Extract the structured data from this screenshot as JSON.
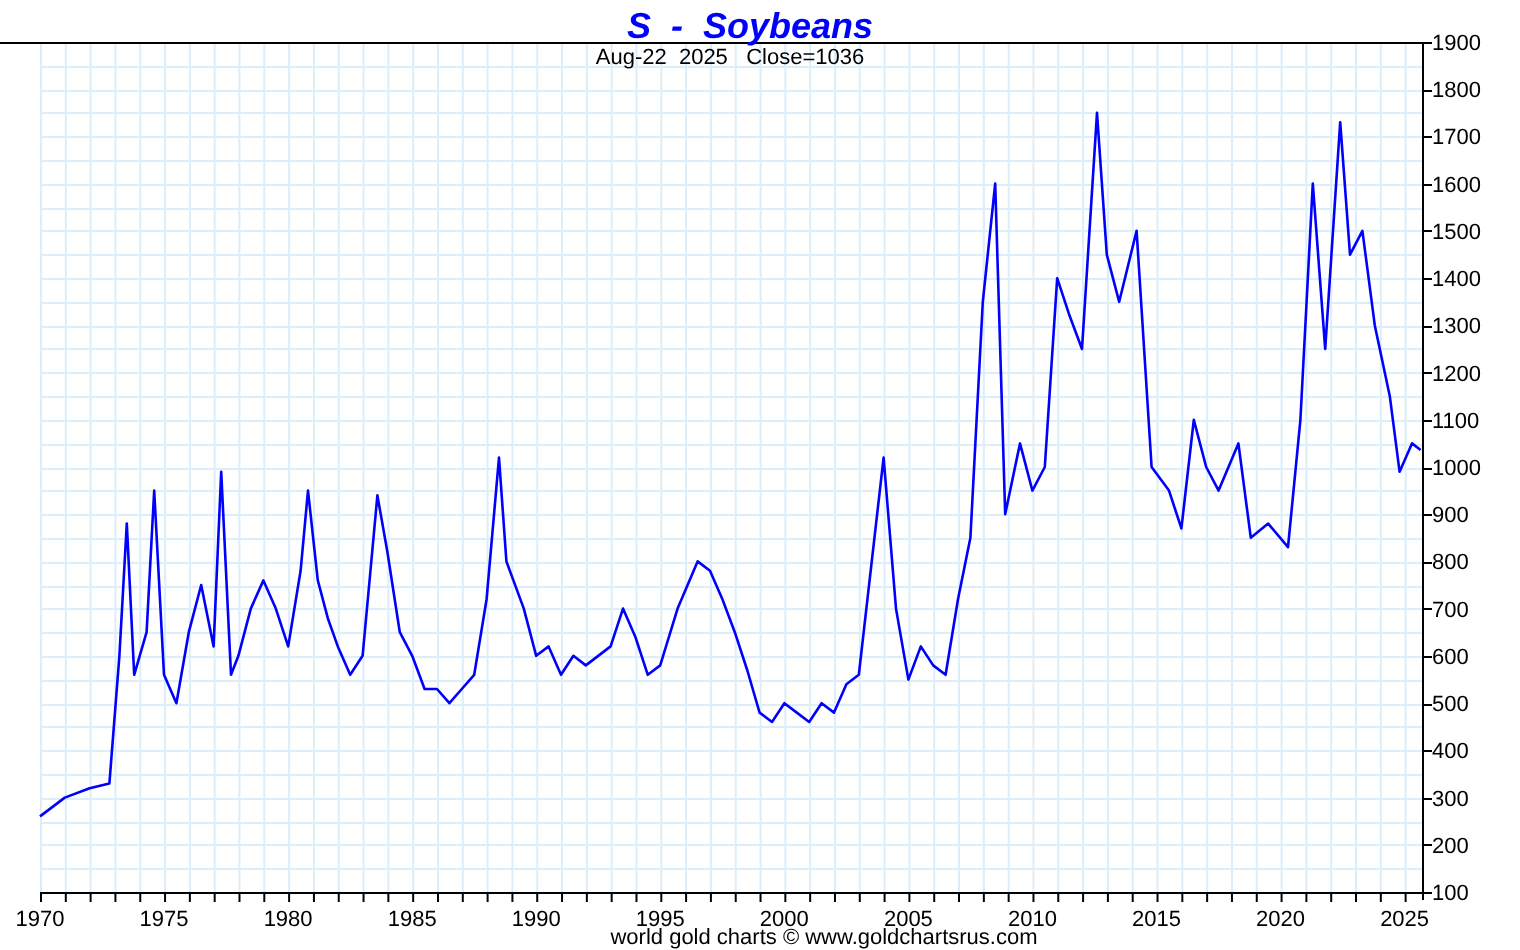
{
  "chart": {
    "title": "S  -  Soybeans",
    "subtitle": "Aug-22  2025   Close=1036",
    "chart_data": {
      "type": "line",
      "x": [
        1970,
        1971,
        1972,
        1972.8,
        1973.2,
        1973.5,
        1973.8,
        1974.3,
        1974.6,
        1975,
        1975.5,
        1976,
        1976.5,
        1977,
        1977.3,
        1977.7,
        1978,
        1978.5,
        1979,
        1979.5,
        1980,
        1980.5,
        1980.8,
        1981.2,
        1981.6,
        1982,
        1982.5,
        1983,
        1983.6,
        1984,
        1984.5,
        1985,
        1985.5,
        1986,
        1986.5,
        1987,
        1987.5,
        1988,
        1988.5,
        1988.8,
        1989.5,
        1990,
        1990.5,
        1991,
        1991.5,
        1992,
        1993,
        1993.5,
        1994,
        1994.5,
        1995,
        1995.7,
        1996.5,
        1997,
        1997.5,
        1998,
        1998.5,
        1999,
        1999.5,
        2000,
        2000.5,
        2001,
        2001.5,
        2002,
        2002.5,
        2003,
        2004,
        2004.5,
        2005,
        2005.5,
        2006,
        2006.5,
        2007,
        2007.5,
        2008,
        2008.5,
        2008.9,
        2009.5,
        2010,
        2010.5,
        2011,
        2011.5,
        2012,
        2012.6,
        2013,
        2013.5,
        2014.2,
        2014.8,
        2015.5,
        2016,
        2016.5,
        2017,
        2017.5,
        2018.3,
        2018.8,
        2019.5,
        2020.3,
        2020.8,
        2021.3,
        2021.8,
        2022.4,
        2022.8,
        2023.3,
        2023.8,
        2024.4,
        2024.8,
        2025.3,
        2025.64
      ],
      "series": [
        {
          "color": "#0000ff",
          "values": [
            260,
            300,
            320,
            330,
            600,
            880,
            560,
            650,
            950,
            560,
            500,
            650,
            750,
            620,
            990,
            560,
            600,
            700,
            760,
            700,
            620,
            780,
            950,
            760,
            680,
            620,
            560,
            600,
            940,
            820,
            650,
            600,
            530,
            530,
            500,
            530,
            560,
            720,
            1020,
            800,
            700,
            600,
            620,
            560,
            600,
            580,
            620,
            700,
            640,
            560,
            580,
            700,
            800,
            780,
            720,
            650,
            570,
            480,
            460,
            500,
            480,
            460,
            500,
            480,
            540,
            560,
            1020,
            700,
            550,
            620,
            580,
            560,
            720,
            850,
            1350,
            1600,
            900,
            1050,
            950,
            1000,
            1400,
            1320,
            1250,
            1750,
            1450,
            1350,
            1500,
            1000,
            950,
            870,
            1100,
            1000,
            950,
            1050,
            850,
            880,
            830,
            1100,
            1600,
            1250,
            1730,
            1450,
            1500,
            1300,
            1150,
            990,
            1050,
            1036
          ]
        }
      ],
      "grid": true,
      "xlim": [
        1970,
        2025.7
      ],
      "ylim": [
        100,
        1900
      ],
      "xticks": [
        1970,
        1975,
        1980,
        1985,
        1990,
        1995,
        2000,
        2005,
        2010,
        2015,
        2020,
        2025
      ],
      "yticks": [
        100,
        200,
        300,
        400,
        500,
        600,
        700,
        800,
        900,
        1000,
        1100,
        1200,
        1300,
        1400,
        1500,
        1600,
        1700,
        1800,
        1900
      ]
    }
  },
  "footer": "world gold charts © www.goldchartsrus.com"
}
